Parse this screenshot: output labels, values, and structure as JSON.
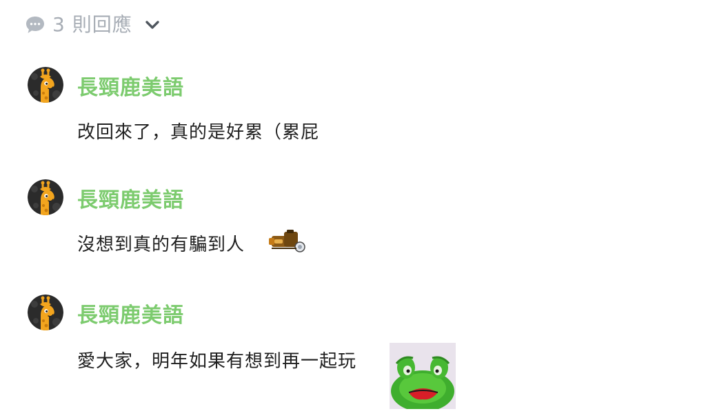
{
  "replies_toggle": {
    "label": "3 則回應",
    "icon": "comment-bubble-icon",
    "chevron_icon": "chevron-down-icon",
    "color": "#a7adb5"
  },
  "accent_color": "#7ccb6e",
  "comments": [
    {
      "author": "長頸鹿美語",
      "text": "改回來了，真的是好累（累屁",
      "avatar_icon": "giraffe-avatar-icon"
    },
    {
      "author": "長頸鹿美語",
      "text": "沒想到真的有騙到人",
      "avatar_icon": "giraffe-avatar-icon",
      "emoji_icon": "trophy-camera-emoji-icon"
    },
    {
      "author": "長頸鹿美語",
      "text": "愛大家，明年如果有想到再一起玩",
      "avatar_icon": "giraffe-avatar-icon",
      "sticker_icon": "kermit-frog-sticker-icon"
    }
  ]
}
